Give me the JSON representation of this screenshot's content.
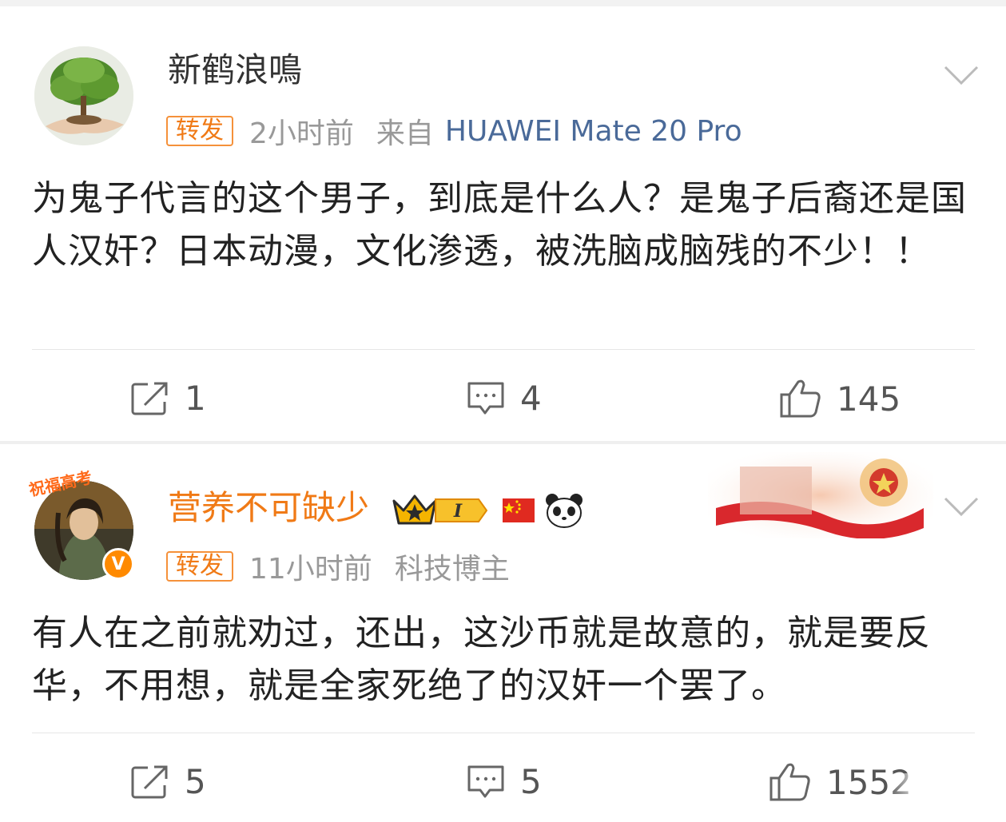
{
  "posts": [
    {
      "username": "新鹤浪鳴",
      "repost_tag": "转发",
      "time": "2小时前",
      "source_prefix": "来自",
      "device": "HUAWEI Mate 20 Pro",
      "content": "为鬼子代言的这个男子，到底是什么人？是鬼子后裔还是国人汉奸？日本动漫，文化渗透，被洗脑成脑残的不少！！",
      "reposts": "1",
      "comments": "4",
      "likes": "145"
    },
    {
      "username": "营养不可缺少",
      "repost_tag": "转发",
      "time": "11小时前",
      "user_tag": "科技博主",
      "avatar_caption": "祝福高考",
      "level_badge": "I",
      "verified_badge": "V",
      "content": "有人在之前就劝过，还出，这沙币就是故意的，就是要反华，不用想，就是全家死绝了的汉奸一个罢了。",
      "reposts": "5",
      "comments": "5",
      "likes": "1552"
    }
  ],
  "icons": [
    "repost-icon",
    "comment-icon",
    "like-icon",
    "chevron-down-icon",
    "crown-icon",
    "china-flag-icon",
    "panda-icon"
  ],
  "colors": {
    "username_vip": "#f07a16",
    "device_link": "#4a6a99",
    "meta_gray": "#999999",
    "repost_tag": "#f5913a"
  }
}
